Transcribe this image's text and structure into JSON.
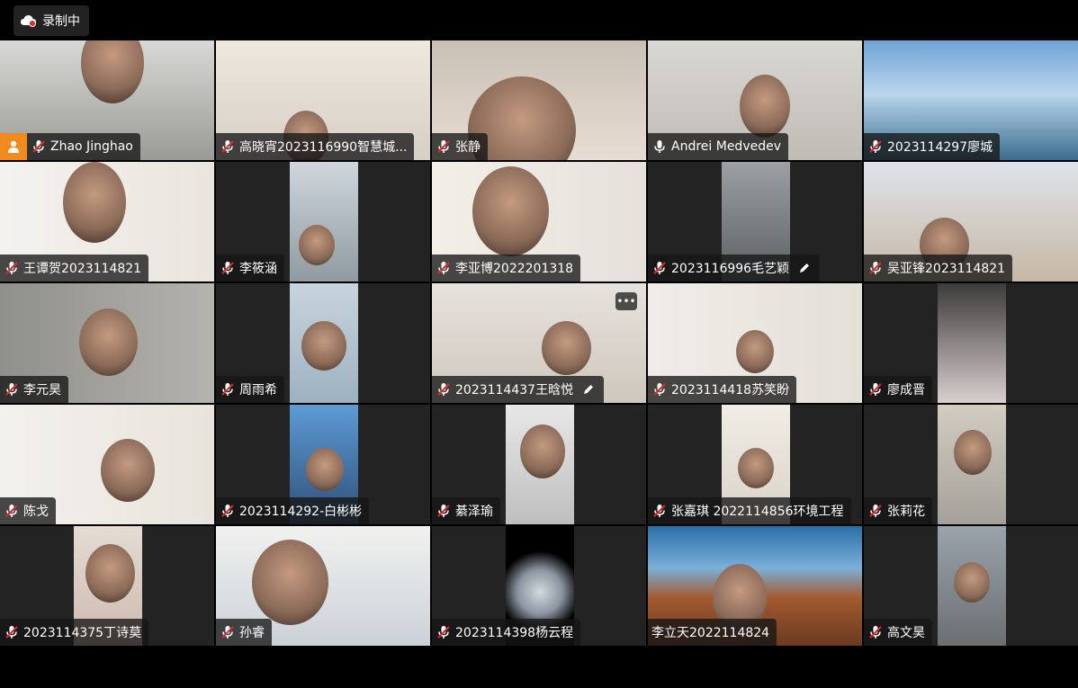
{
  "recording": {
    "label": "录制中"
  },
  "colors": {
    "host_badge": "#f38a1f",
    "muted_icon": "#ffffff"
  },
  "participants": [
    {
      "name": "Zhao Jinghao",
      "mic": "muted",
      "host": true
    },
    {
      "name": "高晓宵2023116990智慧城...",
      "mic": "muted"
    },
    {
      "name": "张静",
      "mic": "muted"
    },
    {
      "name": "Andrei Medvedev",
      "mic": "on"
    },
    {
      "name": "2023114297廖城",
      "mic": "muted"
    },
    {
      "name": "王谭贺2023114821",
      "mic": "muted"
    },
    {
      "name": "李筱涵",
      "mic": "muted"
    },
    {
      "name": "李亚博2022201318",
      "mic": "muted"
    },
    {
      "name": "2023116996毛艺颖",
      "mic": "muted",
      "renamed": true
    },
    {
      "name": "吴亚锋2023114821",
      "mic": "muted"
    },
    {
      "name": "李元昊",
      "mic": "muted"
    },
    {
      "name": "周雨希",
      "mic": "muted"
    },
    {
      "name": "2023114437王晗悦",
      "mic": "muted",
      "renamed": true,
      "more_menu": true
    },
    {
      "name": "2023114418苏笑盼",
      "mic": "muted"
    },
    {
      "name": "廖成晋",
      "mic": "muted"
    },
    {
      "name": "陈戈",
      "mic": "muted"
    },
    {
      "name": "2023114292-白彬彬",
      "mic": "muted"
    },
    {
      "name": "綦泽瑜",
      "mic": "muted"
    },
    {
      "name": "张嘉琪 2022114856环境工程",
      "mic": "muted"
    },
    {
      "name": "张莉花",
      "mic": "muted"
    },
    {
      "name": "2023114375丁诗莫",
      "mic": "muted"
    },
    {
      "name": "孙睿",
      "mic": "muted"
    },
    {
      "name": "2023114398杨云程",
      "mic": "muted"
    },
    {
      "name": "李立天2022114824",
      "mic": "none"
    },
    {
      "name": "高文昊",
      "mic": "muted"
    }
  ]
}
